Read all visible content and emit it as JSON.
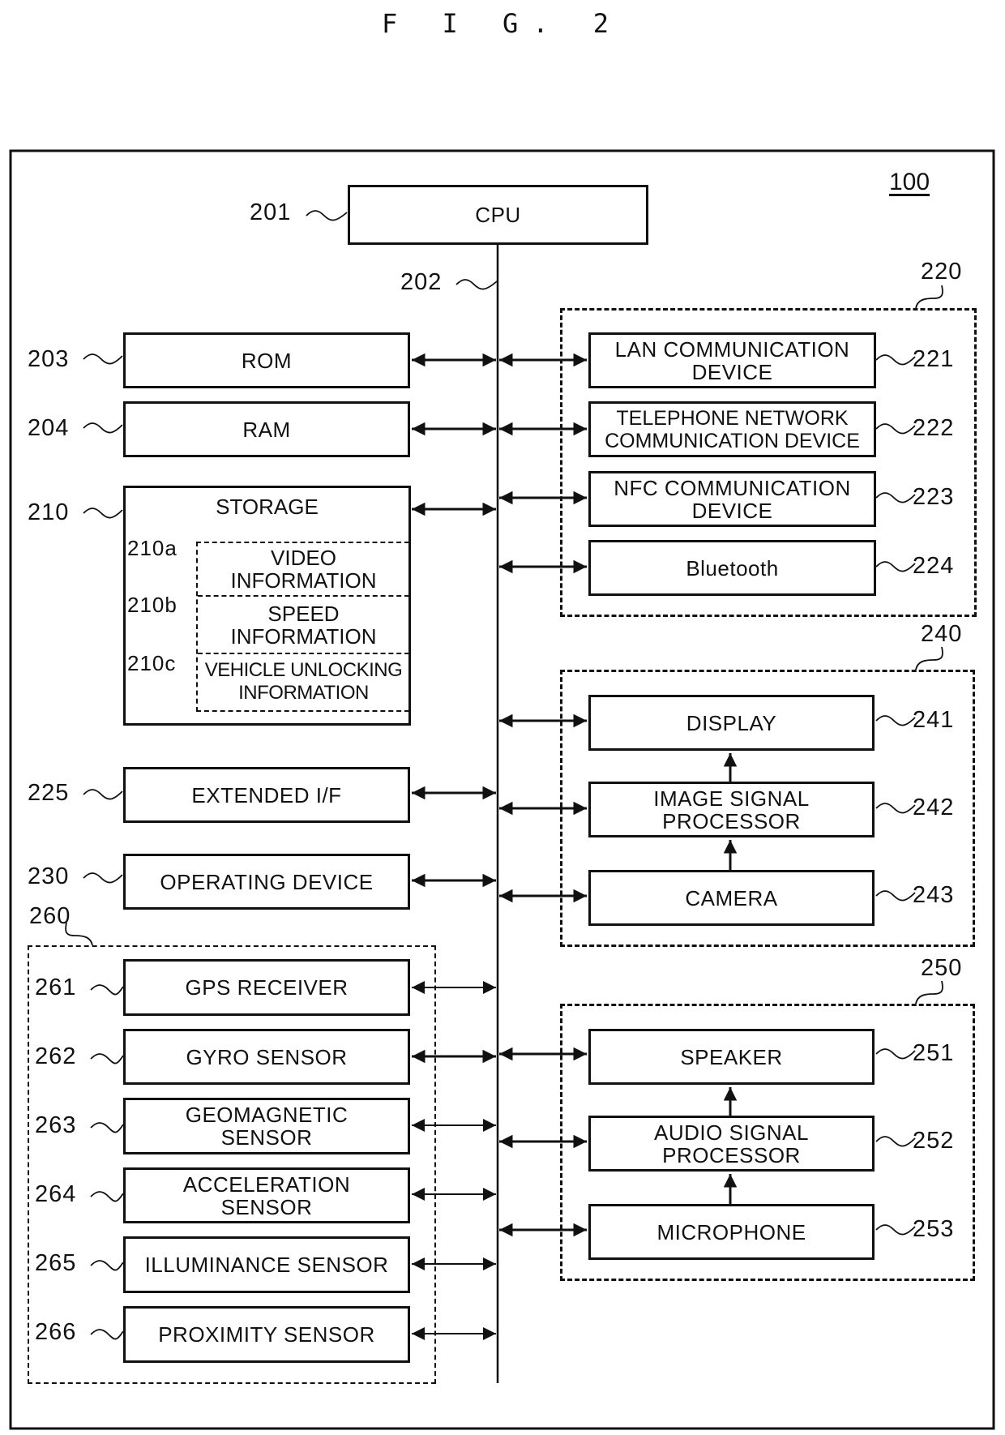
{
  "figure_title": "F I G. 2",
  "system": {
    "ref": "100"
  },
  "cpu": {
    "ref": "201",
    "label": "CPU"
  },
  "bus": {
    "ref": "202"
  },
  "left_blocks": [
    {
      "ref": "203",
      "label": "ROM"
    },
    {
      "ref": "204",
      "label": "RAM"
    },
    {
      "ref": "225",
      "label": "EXTENDED I/F"
    },
    {
      "ref": "230",
      "label": "OPERATING DEVICE"
    }
  ],
  "storage": {
    "ref": "210",
    "label": "STORAGE",
    "items": [
      {
        "ref": "210a",
        "label": "VIDEO\nINFORMATION"
      },
      {
        "ref": "210b",
        "label": "SPEED\nINFORMATION"
      },
      {
        "ref": "210c",
        "label": "VEHICLE UNLOCKING\nINFORMATION"
      }
    ]
  },
  "communication_group": {
    "ref": "220",
    "items": [
      {
        "ref": "221",
        "label": "LAN COMMUNICATION\nDEVICE"
      },
      {
        "ref": "222",
        "label": "TELEPHONE NETWORK\nCOMMUNICATION DEVICE"
      },
      {
        "ref": "223",
        "label": "NFC COMMUNICATION\nDEVICE"
      },
      {
        "ref": "224",
        "label": "Bluetooth"
      }
    ]
  },
  "video_group": {
    "ref": "240",
    "items": [
      {
        "ref": "241",
        "label": "DISPLAY"
      },
      {
        "ref": "242",
        "label": "IMAGE SIGNAL\nPROCESSOR"
      },
      {
        "ref": "243",
        "label": "CAMERA"
      }
    ]
  },
  "audio_group": {
    "ref": "250",
    "items": [
      {
        "ref": "251",
        "label": "SPEAKER"
      },
      {
        "ref": "252",
        "label": "AUDIO SIGNAL\nPROCESSOR"
      },
      {
        "ref": "253",
        "label": "MICROPHONE"
      }
    ]
  },
  "sensor_group": {
    "ref": "260",
    "items": [
      {
        "ref": "261",
        "label": "GPS RECEIVER"
      },
      {
        "ref": "262",
        "label": "GYRO SENSOR"
      },
      {
        "ref": "263",
        "label": "GEOMAGNETIC\nSENSOR"
      },
      {
        "ref": "264",
        "label": "ACCELERATION\nSENSOR"
      },
      {
        "ref": "265",
        "label": "ILLUMINANCE SENSOR"
      },
      {
        "ref": "266",
        "label": "PROXIMITY SENSOR"
      }
    ]
  }
}
